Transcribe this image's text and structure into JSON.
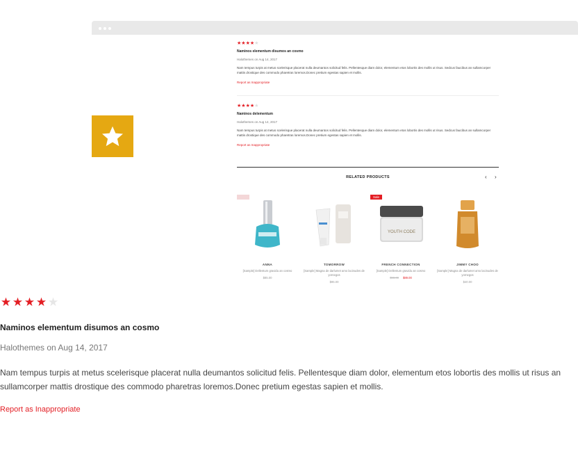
{
  "preview": {
    "reviews": [
      {
        "rating": 4,
        "title": "Naminos elementum disumos an cosmo",
        "meta": "Halothemes on Aug 14, 2017",
        "body": "Nam tempus turpis at metus scelerisque placerat nulla deumantos solicitud felis. Pellentesque diam dolor, elementum etos lobortis des mollis ut risus. Sedcus faucibus an sullamcorper mattis drostique des commodo pharetras loremos.Donec pretium egestas sapien et mollis.",
        "report": "Report as Inappropriate"
      },
      {
        "rating": 4,
        "title": "Naminos delementum",
        "meta": "Halothemes on Aug 14, 2017",
        "body": "Nam tempus turpis at metus scelerisque placerat nulla deumantos solicitud felis. Pellentesque diam dolor, elementum etos lobortis des mollis ut risus. Sedcus faucibus an sullamcorper mattis drostique des commodo pharetras loremos.Donec pretium egestas sapien et mollis.",
        "report": "Report as Inappropriate"
      }
    ],
    "related_title": "RELATED PRODUCTS",
    "nav_prev": "‹",
    "nav_next": "›",
    "products": [
      {
        "name": "ANNA",
        "desc": "[Sample] Dellentum gravidu an cosmo",
        "price": "$85.00",
        "tag": ""
      },
      {
        "name": "TOMORROW",
        "desc": "[Sample] Magna de darlumet amo lacinudes de yornegos",
        "price": "$95.00",
        "tag": ""
      },
      {
        "name": "FRENCH CONNECTION",
        "desc": "[Sample] Dellentum gravidu an cosmo",
        "old_price": "$98.00",
        "price": "$89.00",
        "tag": "Sale"
      },
      {
        "name": "JIMMY CHOO",
        "desc": "[Sample] Magna de darlumet amo lacinudes de yornegos",
        "price": "$40.00",
        "tag": ""
      }
    ],
    "jar_label": "YOUTH CODE"
  },
  "review": {
    "rating": 4,
    "max_rating": 5,
    "title": "Naminos elementum disumos an cosmo",
    "meta": "Halothemes on Aug 14, 2017",
    "body": "Nam tempus turpis at metus scelerisque placerat nulla deumantos solicitud felis. Pellentesque diam dolor, elementum etos lobortis des mollis ut risus an sullamcorper mattis drostique des commodo pharetras loremos.Donec pretium egestas sapien et mollis.",
    "report_label": "Report as Inappropriate"
  },
  "colors": {
    "accent": "#e31e24",
    "badge": "#e5a812",
    "browser_bar": "#e9e9e9"
  },
  "icons": {
    "badge": "star-icon",
    "rating": "star-icon"
  }
}
